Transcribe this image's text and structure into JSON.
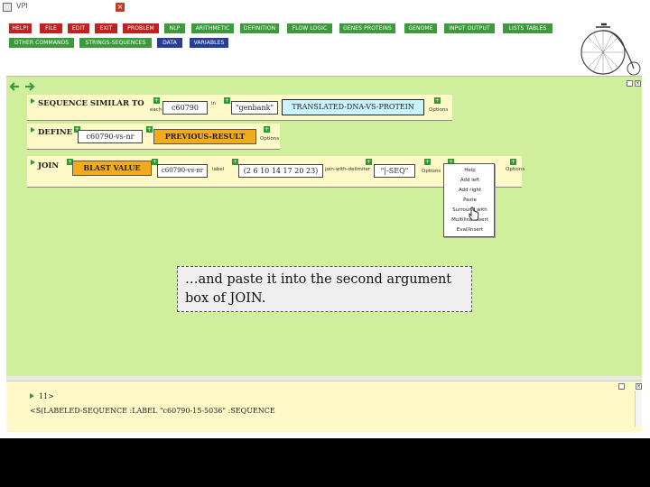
{
  "window": {
    "title": "VPI"
  },
  "menu": {
    "row1": [
      "HELP!",
      "FILE",
      "EDIT",
      "EXIT",
      "PROBLEM",
      "NLP",
      "ARITHMETIC",
      "DEFINITION",
      "FLOW LOGIC",
      "GENES PROTEINS",
      "GENOME",
      "INPUT OUTPUT",
      "LISTS TABLES"
    ],
    "row2": [
      "OTHER COMMANDS",
      "STRINGS-SEQUENCES",
      "DATA",
      "VARIABLES"
    ]
  },
  "rows": {
    "seq_sim": {
      "keyword": "SEQUENCE SIMILAR TO",
      "each_label": "each",
      "arg1": "c60790",
      "in_label": "in",
      "arg2": "\"genbank\"",
      "arg3": "TRANSLATED-DNA-VS-PROTEIN",
      "options": "Options"
    },
    "define": {
      "keyword": "DEFINE",
      "arg1": "c60790-vs-nr",
      "arg2": "PREVIOUS-RESULT",
      "options": "Options"
    },
    "join": {
      "keyword": "JOIN",
      "arg1": "BLAST VALUE",
      "arg2": "c60790-vs-nr",
      "label_two": "label",
      "arg3": "(2 6 10 14 17 20 23)",
      "label_three": "join-with-delimiter",
      "arg4": "\"|-SEQ\"",
      "options": "Options",
      "options2": "Options"
    }
  },
  "context_menu": {
    "items": [
      "Help",
      "Add left",
      "Add right",
      "Paste",
      "Surround with",
      "Multiline insert",
      "Eval/Insert"
    ]
  },
  "callout": {
    "text": "…and paste it into the second argument box of JOIN."
  },
  "console": {
    "line1": "11>",
    "line2": "<S(LABELED-SEQUENCE :LABEL \"c60790-15-5036\" :SEQUENCE"
  },
  "colors": {
    "workspace": "#cfef9d",
    "red": "#c02121",
    "green": "#3c9a3c",
    "blue": "#263e96",
    "orange": "#f3ab1b",
    "cyan": "#c8f5ff"
  }
}
